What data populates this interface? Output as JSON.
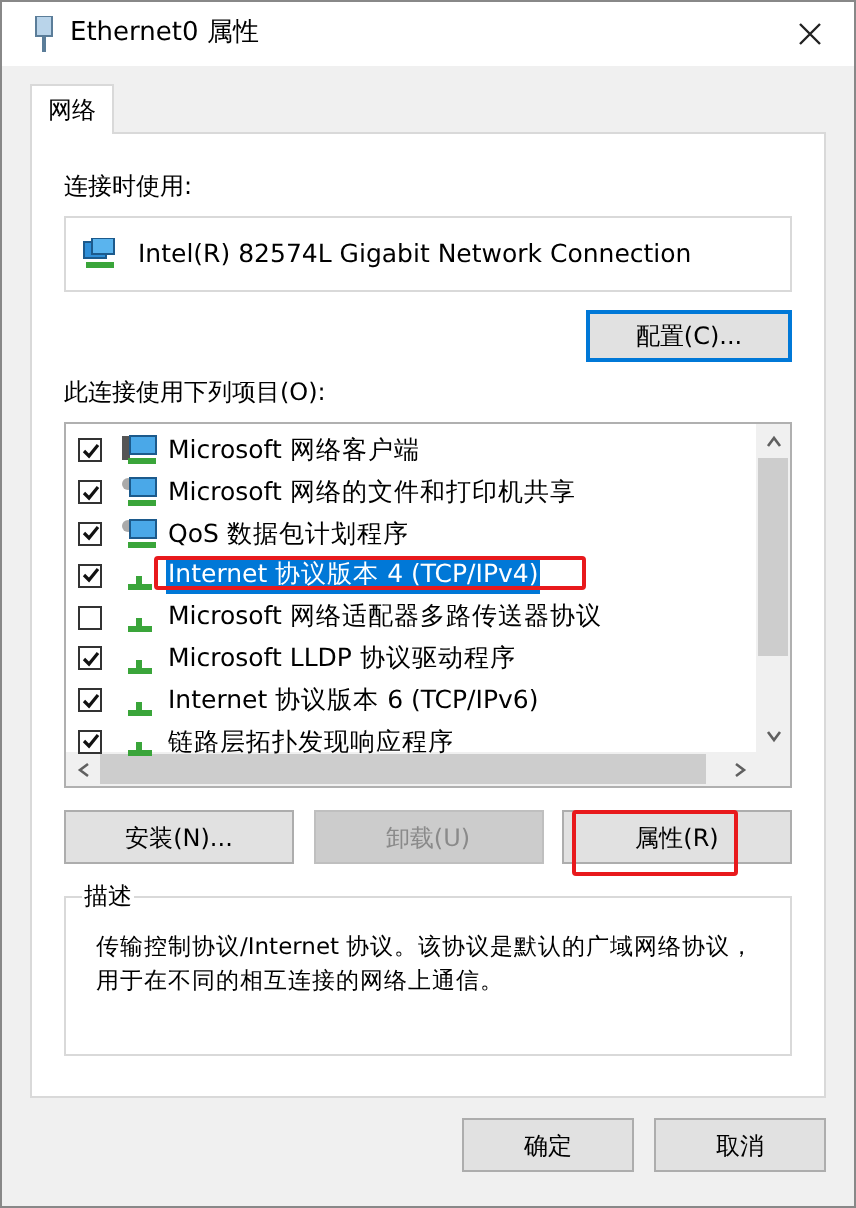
{
  "window": {
    "title": "Ethernet0 属性"
  },
  "tabs": [
    {
      "label": "网络",
      "selected": true
    }
  ],
  "connect_using": {
    "label": "连接时使用:",
    "adapter": "Intel(R) 82574L Gigabit Network Connection"
  },
  "configure_button": {
    "label": "配置(C)...",
    "focused": true
  },
  "items_label": "此连接使用下列项目(O):",
  "items": [
    {
      "kind": "client",
      "label": "Microsoft 网络客户端",
      "checked": true,
      "selected": false,
      "annotated": false
    },
    {
      "kind": "service",
      "label": "Microsoft 网络的文件和打印机共享",
      "checked": true,
      "selected": false,
      "annotated": false
    },
    {
      "kind": "service",
      "label": "QoS 数据包计划程序",
      "checked": true,
      "selected": false,
      "annotated": false
    },
    {
      "kind": "protocol",
      "label": "Internet 协议版本 4 (TCP/IPv4)",
      "checked": true,
      "selected": true,
      "annotated": true
    },
    {
      "kind": "protocol",
      "label": "Microsoft 网络适配器多路传送器协议",
      "checked": false,
      "selected": false,
      "annotated": false
    },
    {
      "kind": "protocol",
      "label": "Microsoft LLDP 协议驱动程序",
      "checked": true,
      "selected": false,
      "annotated": false
    },
    {
      "kind": "protocol",
      "label": "Internet 协议版本 6 (TCP/IPv6)",
      "checked": true,
      "selected": false,
      "annotated": false
    },
    {
      "kind": "protocol",
      "label": "链路层拓扑发现响应程序",
      "checked": true,
      "selected": false,
      "annotated": false
    }
  ],
  "action_buttons": [
    {
      "label": "安装(N)...",
      "disabled": false,
      "annotated": false
    },
    {
      "label": "卸载(U)",
      "disabled": true,
      "annotated": false
    },
    {
      "label": "属性(R)",
      "disabled": false,
      "annotated": true
    }
  ],
  "description": {
    "title": "描述",
    "text": "传输控制协议/Internet 协议。该协议是默认的广域网络协议，用于在不同的相互连接的网络上通信。"
  },
  "dialog_buttons": [
    {
      "label": "确定"
    },
    {
      "label": "取消"
    }
  ]
}
